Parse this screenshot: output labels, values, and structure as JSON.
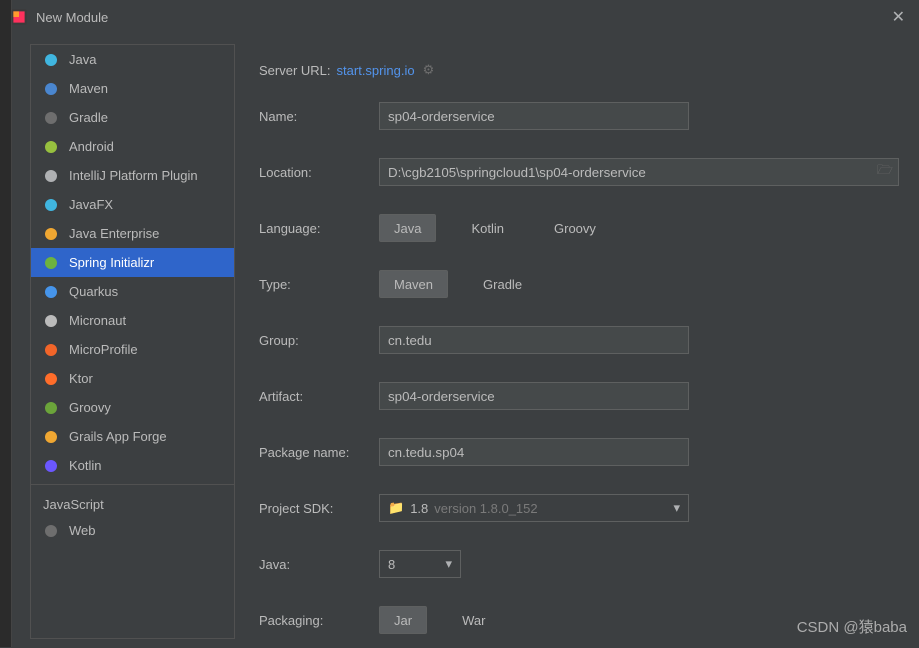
{
  "window": {
    "title": "New Module"
  },
  "sidebar": {
    "items": [
      {
        "label": "Java",
        "icon": "java",
        "color": "#40b6e0"
      },
      {
        "label": "Maven",
        "icon": "m",
        "color": "#4a86cf"
      },
      {
        "label": "Gradle",
        "icon": "gradle",
        "color": "#6e6e6e"
      },
      {
        "label": "Android",
        "icon": "android",
        "color": "#97c03f"
      },
      {
        "label": "IntelliJ Platform Plugin",
        "icon": "plugin",
        "color": "#afb1b3"
      },
      {
        "label": "JavaFX",
        "icon": "javafx",
        "color": "#40b6e0"
      },
      {
        "label": "Java Enterprise",
        "icon": "jee",
        "color": "#f0a732"
      },
      {
        "label": "Spring Initializr",
        "icon": "spring",
        "color": "#6db33f",
        "selected": true
      },
      {
        "label": "Quarkus",
        "icon": "quarkus",
        "color": "#4695eb"
      },
      {
        "label": "Micronaut",
        "icon": "micronaut",
        "color": "#bbbbbb"
      },
      {
        "label": "MicroProfile",
        "icon": "microprofile",
        "color": "#f26529"
      },
      {
        "label": "Ktor",
        "icon": "ktor",
        "color": "#ff6d2a"
      },
      {
        "label": "Groovy",
        "icon": "groovy",
        "color": "#6ba43a"
      },
      {
        "label": "Grails App Forge",
        "icon": "grails",
        "color": "#f0a732"
      },
      {
        "label": "Kotlin",
        "icon": "kotlin",
        "color": "#6b57ff"
      }
    ],
    "group": "JavaScript",
    "footer": [
      {
        "label": "Web",
        "icon": "web",
        "color": "#6e6e6e"
      }
    ]
  },
  "form": {
    "serverUrlLabel": "Server URL:",
    "serverUrl": "start.spring.io",
    "nameLabel": "Name:",
    "name": "sp04-orderservice",
    "locationLabel": "Location:",
    "location": "D:\\cgb2105\\springcloud1\\sp04-orderservice",
    "languageLabel": "Language:",
    "languages": [
      "Java",
      "Kotlin",
      "Groovy"
    ],
    "languageSelected": "Java",
    "typeLabel": "Type:",
    "types": [
      "Maven",
      "Gradle"
    ],
    "typeSelected": "Maven",
    "groupLabel": "Group:",
    "group": "cn.tedu",
    "artifactLabel": "Artifact:",
    "artifact": "sp04-orderservice",
    "packageLabel": "Package name:",
    "package": "cn.tedu.sp04",
    "sdkLabel": "Project SDK:",
    "sdkValue": "1.8",
    "sdkVersion": "version 1.8.0_152",
    "javaLabel": "Java:",
    "javaValue": "8",
    "packagingLabel": "Packaging:",
    "packagings": [
      "Jar",
      "War"
    ],
    "packagingSelected": "Jar"
  },
  "watermark": "CSDN @猿baba"
}
